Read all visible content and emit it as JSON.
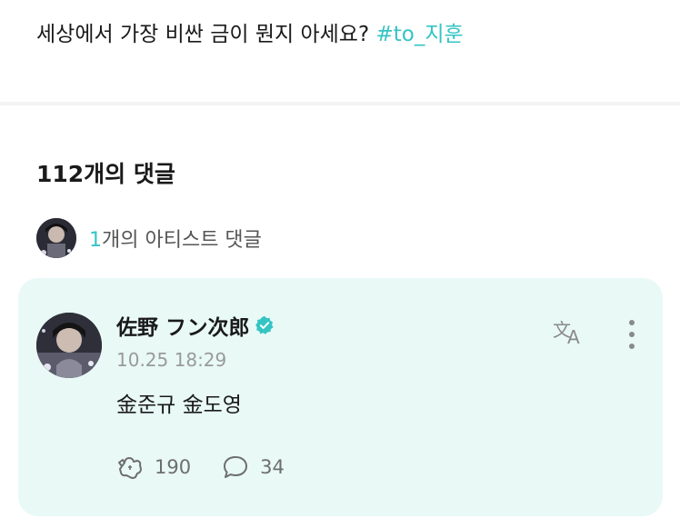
{
  "post": {
    "text": "세상에서 가장 비싼 금이 뭔지 아세요? ",
    "hashtag": "#to_지훈"
  },
  "comments": {
    "count_label": "112개의 댓글",
    "artist_count": "1",
    "artist_label": "개의 아티스트 댓글"
  },
  "comment": {
    "author": "佐野 フン次郎",
    "timestamp": "10.25 18:29",
    "body": "金준규 金도영",
    "likes": "190",
    "replies": "34"
  },
  "colors": {
    "accent": "#35c4c4",
    "card_bg": "#e8f9f6"
  },
  "icons": [
    "translate-icon",
    "more-vertical-icon",
    "like-icon",
    "reply-icon",
    "verified-badge-icon"
  ]
}
